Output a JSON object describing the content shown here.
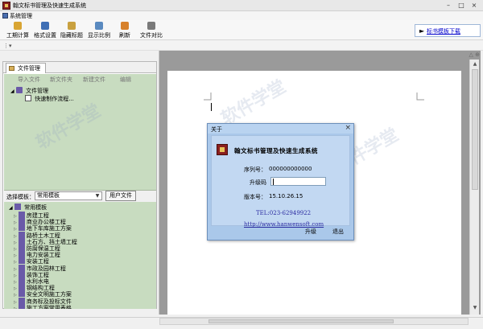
{
  "window": {
    "title": "翰文标书管理及快速生成系统"
  },
  "menu": {
    "system": "系统管理"
  },
  "toolbar": {
    "buttons": [
      {
        "label": "工期计算",
        "color": "#d9a533"
      },
      {
        "label": "格式设置",
        "color": "#3f6fb5"
      },
      {
        "label": "隐藏标题",
        "color": "#c9a140"
      },
      {
        "label": "显示比例",
        "color": "#5a8ac0"
      },
      {
        "label": "刷新",
        "color": "#d7812b"
      },
      {
        "label": "文件对比",
        "color": "#7a7a7a"
      }
    ],
    "download_link": "标书模板下载"
  },
  "file_panel": {
    "tab_label": "文件管理",
    "actions": [
      "导入文件",
      "新文件夹",
      "新建文件",
      "编辑"
    ],
    "tree": [
      {
        "label": "文件管理",
        "level": 0
      },
      {
        "label": "快速制作流程...",
        "level": 1
      }
    ]
  },
  "template_bar": {
    "label": "选择模板：",
    "selected": "常用模板",
    "user_files_button": "用户文件"
  },
  "template_tree": {
    "root": "常用模板",
    "items": [
      "房建工程",
      "商业办公楼工程",
      "地下车库施工方案",
      "路桥土木工程",
      "土石方、挡土墙工程",
      "防腐保温工程",
      "电力安装工程",
      "安装工程",
      "市政及园林工程",
      "装饰工程",
      "水利水电",
      "钢结构工程",
      "安全文明施工方案",
      "商务标及投标文件",
      "施工方案常用表格"
    ]
  },
  "about_dialog": {
    "title": "关于",
    "close_glyph": "×",
    "app_name": "翰文标书管理及快速生成系统",
    "serial_label": "序列号：",
    "serial_value": "000000000000",
    "upgrade_code_label": "升级码",
    "version_label": "版本号：",
    "version_value": "15.10.26.15",
    "tel": "TEL:023-62949922",
    "url": "http://www.hanwensoft.com",
    "upgrade_button": "升级",
    "exit_button": "退出"
  }
}
